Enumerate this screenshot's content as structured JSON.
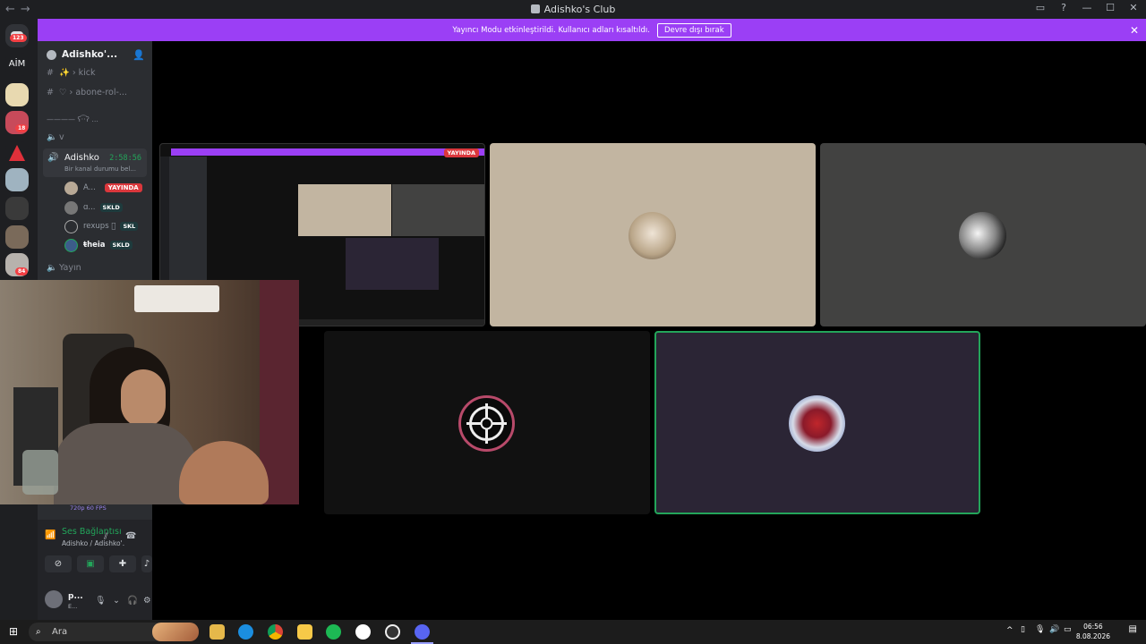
{
  "window": {
    "title": "Adishko's Club",
    "back": "←",
    "forward": "→",
    "controls": [
      "▭",
      "?",
      "—",
      "☐",
      "✕"
    ]
  },
  "banner": {
    "message": "Yayıncı Modu etkinleştirildi. Kullanıcı adları kısaltıldı.",
    "button": "Devre dışı bırak",
    "close": "✕"
  },
  "guilds": {
    "home_badge": "123",
    "aim_label": "AİM",
    "badges": [
      "18",
      "84"
    ]
  },
  "sidebar": {
    "server_name": "Adishko'...",
    "channels": [
      {
        "icon": "#",
        "label": "✨ › kick"
      },
      {
        "icon": "#",
        "label": "♡ › abone-rol-..."
      }
    ],
    "category": "———— ʕ·͡·ʔ ...",
    "voice_channel_v": "v",
    "active_voice": {
      "name": "Adishko",
      "timer": "2:58:56",
      "status": "Bir kanal durumu bel..."
    },
    "users": [
      {
        "name": "A...",
        "badge": "YAYINDA"
      },
      {
        "name": "ɑ...",
        "badge": "SKLD"
      },
      {
        "name": "rexups ⃝",
        "badge": "SKL"
      },
      {
        "name": "ŧheia",
        "badge": "SKLD"
      }
    ],
    "voice_channel_2": "Yayın",
    "stream_quality": "720p 60 FPS"
  },
  "voice_panel": {
    "title": "Ses Bağlantısı K",
    "subtitle": "Adishko / Adishko'...",
    "account_name": "p...",
    "account_status": "E..."
  },
  "stage": {
    "live_badge": "YAYINDA"
  },
  "taskbar": {
    "search_placeholder": "Ara",
    "time": "06:56",
    "date": "8.08.2026"
  },
  "colors": {
    "accent": "#9b3ff5",
    "live": "#da373c",
    "speaking": "#23a55a"
  }
}
